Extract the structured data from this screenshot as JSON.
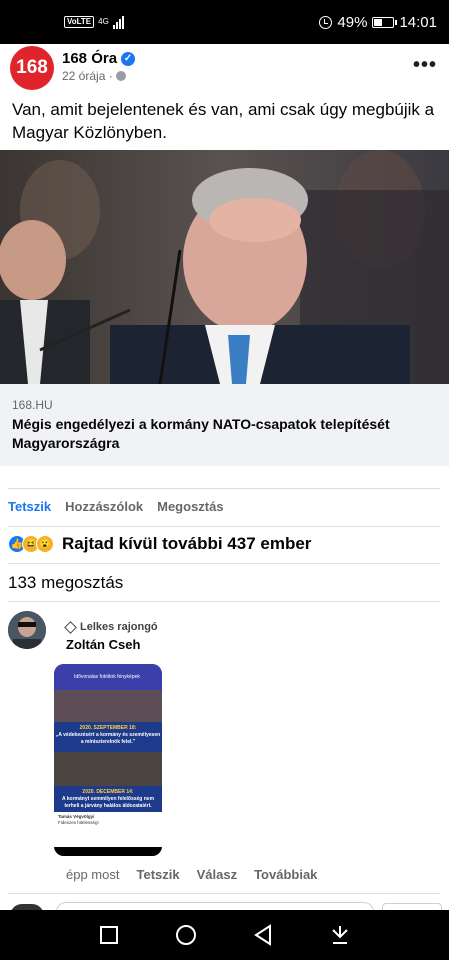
{
  "status_bar": {
    "volte": "VoLTE",
    "network": "4G",
    "battery": "49%",
    "battery_level": 0.49,
    "time": "14:01",
    "signal_icon": "signal-bars-icon",
    "alarm_icon": "alarm-clock-icon"
  },
  "post": {
    "page_logo": "168",
    "page_name": "168 Óra",
    "time_ago": "22 órája ·",
    "text": "Van, amit bejelentenek és van, ami csak úgy megbújik a Magyar Közlönyben.",
    "link": {
      "domain": "168.HU",
      "title": "Mégis engedélyezi a kormány NATO-csapatok telepítését Magyarországra"
    }
  },
  "actions": {
    "like": "Tetszik",
    "comments": "Hozzászólok",
    "share": "Megosztás"
  },
  "reactions": {
    "summary": "Rajtad kívül további 437 ember",
    "types": [
      "like",
      "haha",
      "wow"
    ]
  },
  "shares": "133 megosztás",
  "comment": {
    "badge": "Lelkes rajongó",
    "author": "Zoltán Cseh",
    "screenshot": {
      "header": "Idővonalas fotóitok fényképek",
      "caption1_date": "2020. SZEPTEMBER 18:",
      "caption1_text": "„A védekezésért a kormány és személyesen a miniszterelnök felel.\"",
      "caption2_date": "2020. DECEMBER 14:",
      "caption2_text": "A kormányt semmilyen felelősség nem terheli a járvány halálos áldozataiért.",
      "card_name": "Tamás Végvölgyi",
      "card_text": "Fideszes hitelesség!"
    },
    "time": "épp most",
    "like": "Tetszik",
    "reply": "Válasz",
    "more": "Továbbiak"
  },
  "colors": {
    "brand_red": "#e0242b",
    "facebook_blue": "#1877f2",
    "secondary_text": "#65676b"
  }
}
